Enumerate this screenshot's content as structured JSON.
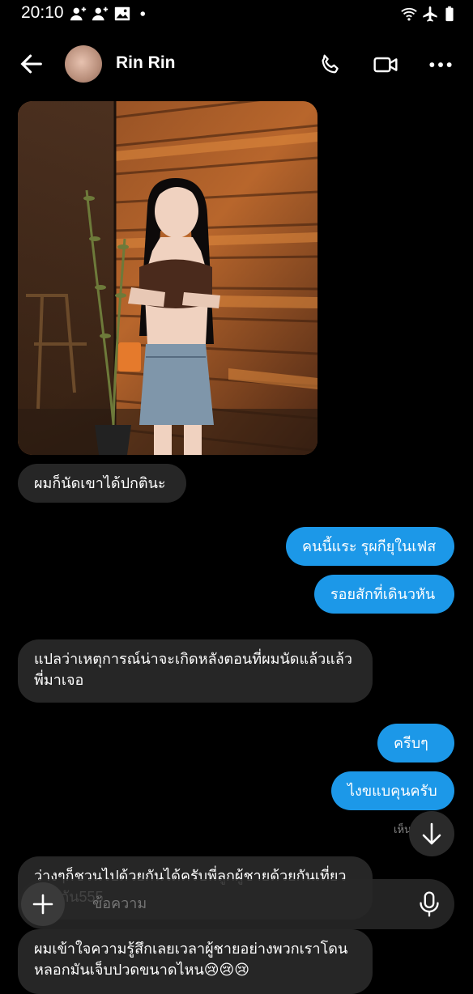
{
  "status_bar": {
    "time": "20:10",
    "icons": [
      "person-add-icon",
      "person-add-icon",
      "image-icon",
      "dot-icon",
      "wifi-icon",
      "airplane-icon",
      "battery-icon"
    ]
  },
  "header": {
    "contact_name": "Rin Rin",
    "icons": [
      "back-arrow-icon",
      "phone-icon",
      "video-call-icon",
      "more-options-icon"
    ]
  },
  "messages": [
    {
      "side": "in",
      "text": "ผมก็นัดเขาได้ปกตินะ"
    },
    {
      "side": "out",
      "text": "คนนี้แระ รุผกียุในเฟส"
    },
    {
      "side": "out",
      "text": "รอยสักที่เดินวหัน"
    },
    {
      "side": "in",
      "text": "แปลว่าเหตุการณ์น่าจะเกิดหลังตอนที่ผมนัดแล้วแล้ว\nพี่มาเจอ"
    },
    {
      "side": "out",
      "text": "ครีบๆ"
    },
    {
      "side": "out",
      "text": "ไงขแบคุนครับ"
    },
    {
      "side": "in",
      "text": "ว่างๆก็ชวนไปด้วยกันได้ครับพี่ลูกผู้ชายด้วยกันเที่ยว\nด้วยกัน555"
    },
    {
      "side": "in",
      "text": "ผมเข้าใจความรู้สึกเลยเวลาผู้ชายอย่างพวกเราโดน\nหลอกมันเจ็บปวดขนาดไหน😢😢😢"
    }
  ],
  "seen_label": "เห็น",
  "composer": {
    "placeholder": "ข้อความ"
  },
  "colors": {
    "background": "#000000",
    "outgoing_bubble": "#1c98e8",
    "incoming_bubble": "#262626"
  }
}
